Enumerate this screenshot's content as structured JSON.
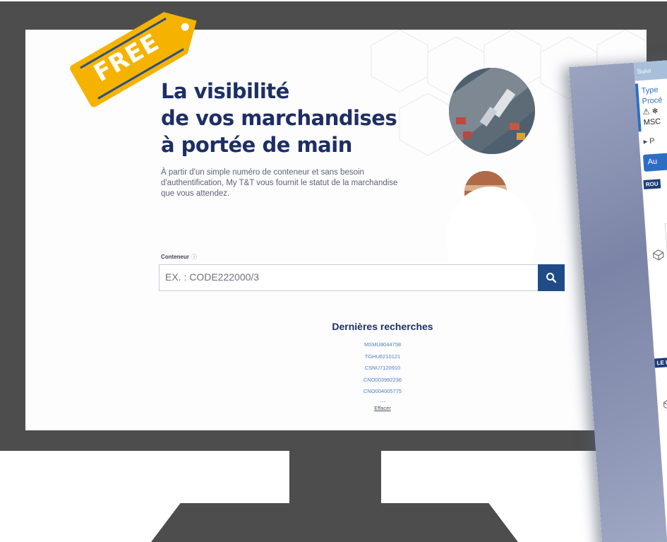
{
  "badge": {
    "label": "FREE"
  },
  "hero": {
    "title_lines": [
      "La visibilité",
      "de vos marchandises",
      "à portée de main"
    ],
    "description": "À partir d'un simple numéro de conteneur et sans besoin d'authentification, My T&T vous fournit le statut de la marchandise que vous attendez."
  },
  "search": {
    "label": "Conteneur",
    "info_icon": "info-icon",
    "placeholder": "EX. : CODE222000/3",
    "button_icon": "search-icon"
  },
  "recent": {
    "title": "Dernières recherches",
    "items": [
      "MSMU8044758",
      "TGHU6210121",
      "CSNU7120910",
      "CNO003992236",
      "CNO004005775"
    ],
    "more": "...",
    "clear": "Effacer"
  },
  "app_panel": {
    "header": "Suivi",
    "line_type": "Type",
    "line_proc": "Procé",
    "icons": "⚠ ❄",
    "carrier": "MSC",
    "toggle": "P",
    "button": "Au",
    "badge_1": "ROU",
    "badge_2": "LE H"
  },
  "colors": {
    "brand_navy": "#1d2f63",
    "search_button": "#1f4c86",
    "link_blue": "#4a7cc0",
    "tag_yellow": "#f5b300",
    "monitor": "#4d4d4d"
  }
}
